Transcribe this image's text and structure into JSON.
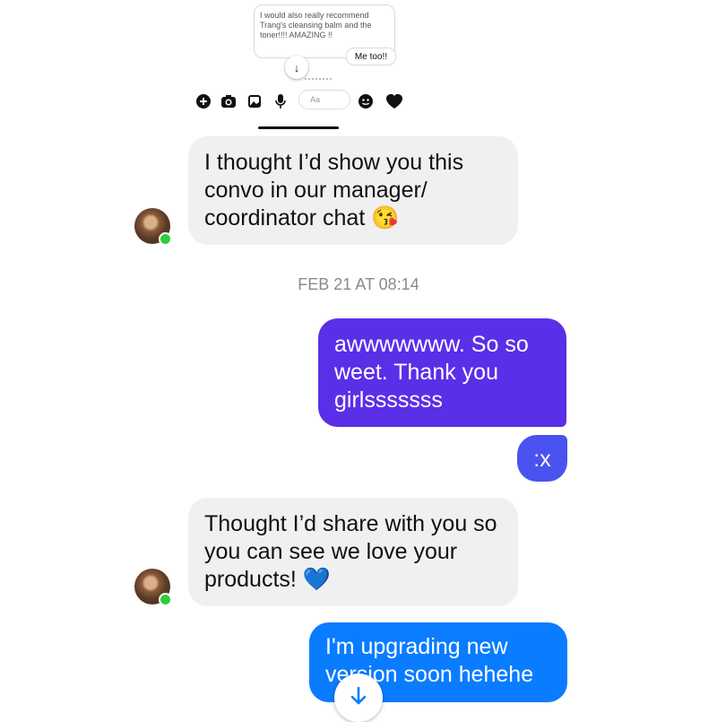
{
  "inner_screenshot": {
    "received_text": "I would also really recommend Trang's cleansing balm and the toner!!!! AMAZING !!",
    "sent_text": "Me too!!",
    "input_placeholder": "Aa",
    "icons": [
      "plus-icon",
      "camera-icon",
      "image-icon",
      "mic-icon",
      "emoji-icon",
      "heart-icon"
    ]
  },
  "messages": {
    "m1": "I thought I’d show you this convo in our manager/ coordinator chat 😘",
    "timestamp": "FEB 21 AT 08:14",
    "m2": "awwwwwww. So so weet. Thank you girlsssssss",
    "m3": ":x",
    "m4": "Thought I’d share with you so you can see we love your products! 💙",
    "m5": "I'm upgrading new version soon hehehe"
  },
  "colors": {
    "sent_purple": "#5b2ee8",
    "sent_blue": "#0a7cff",
    "received_gray": "#f0f0f0",
    "online_green": "#2ecc40"
  }
}
